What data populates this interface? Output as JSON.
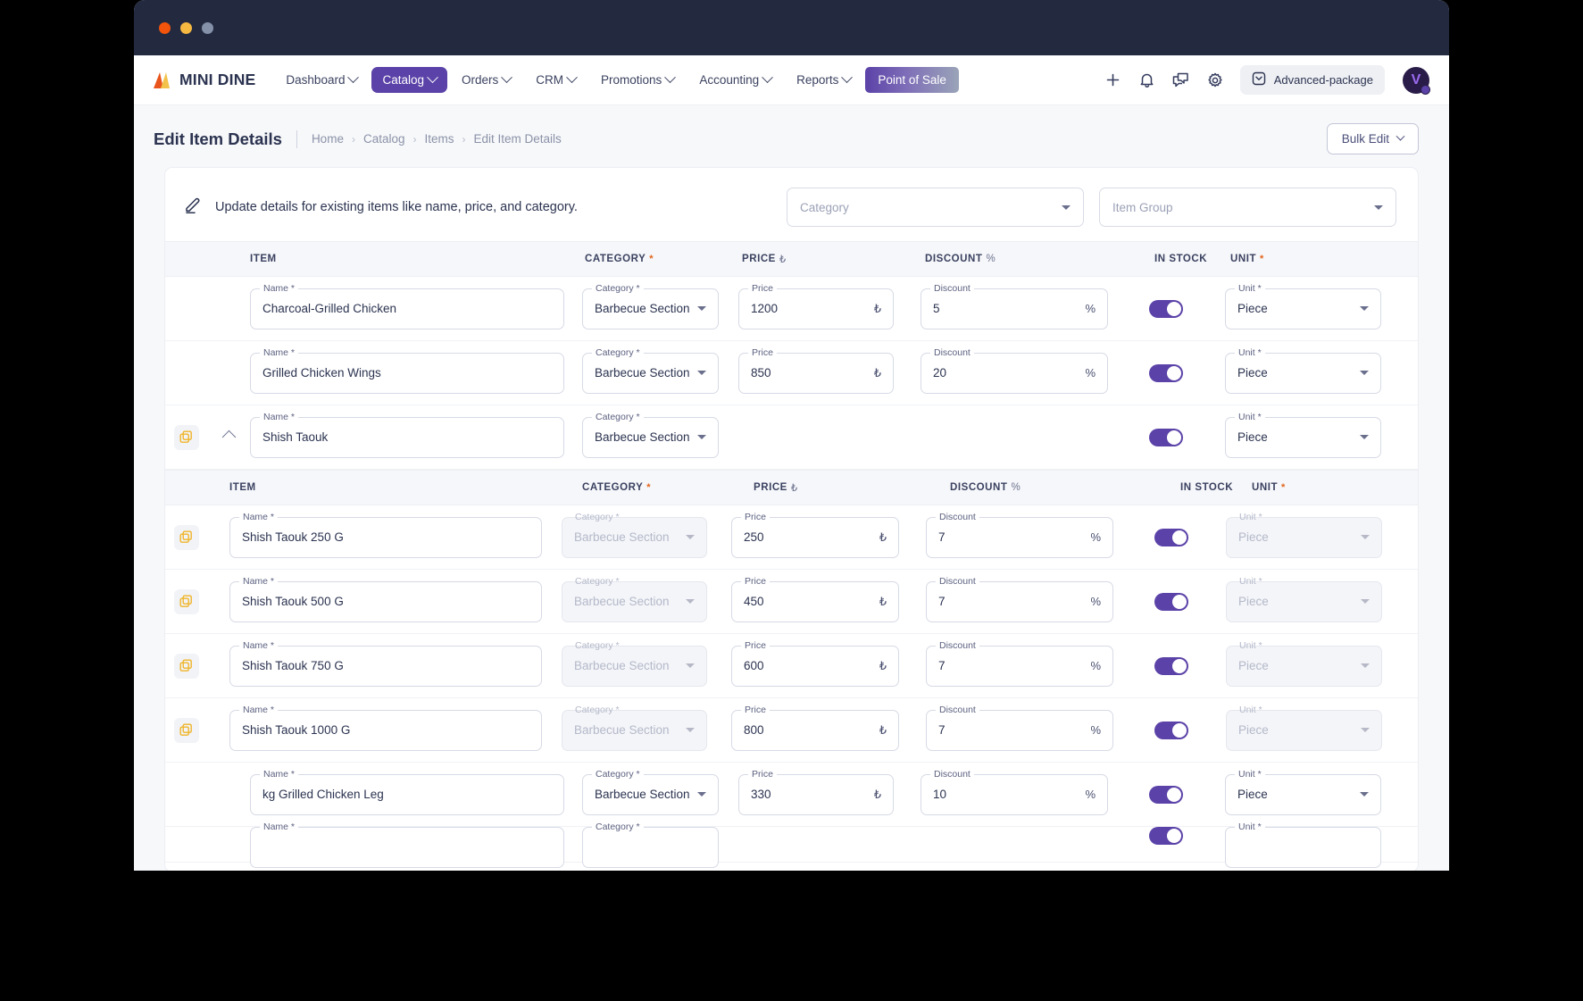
{
  "window": {
    "dots": [
      "close",
      "minimize",
      "maximize"
    ]
  },
  "nav": {
    "brand": "MINI DINE",
    "items": [
      {
        "label": "Dashboard",
        "caret": true,
        "active": false
      },
      {
        "label": "Catalog",
        "caret": true,
        "active": true
      },
      {
        "label": "Orders",
        "caret": true,
        "active": false
      },
      {
        "label": "CRM",
        "caret": true,
        "active": false
      },
      {
        "label": "Promotions",
        "caret": true,
        "active": false
      },
      {
        "label": "Accounting",
        "caret": true,
        "active": false
      },
      {
        "label": "Reports",
        "caret": true,
        "active": false
      }
    ],
    "pos_label": "Point of Sale",
    "icons": [
      "plus-icon",
      "bell-icon",
      "chat-icon",
      "gear-icon"
    ],
    "package_label": "Advanced-package",
    "avatar_initial": "V"
  },
  "header": {
    "title": "Edit Item Details",
    "breadcrumb": [
      "Home",
      "Catalog",
      "Items",
      "Edit Item Details"
    ],
    "bulk_edit_label": "Bulk Edit"
  },
  "card": {
    "description": "Update details for existing items like name, price, and category.",
    "filters": [
      {
        "placeholder": "Category"
      },
      {
        "placeholder": "Item Group"
      }
    ],
    "columns": {
      "item": "ITEM",
      "category": "CATEGORY",
      "price": "PRICE",
      "price_symbol": "₺",
      "discount": "DISCOUNT",
      "discount_symbol": "%",
      "in_stock": "IN STOCK",
      "unit": "UNIT",
      "required_mark": "*"
    },
    "field_labels": {
      "name": "Name *",
      "category": "Category *",
      "price": "Price",
      "discount": "Discount",
      "unit": "Unit *"
    },
    "rows": [
      {
        "name": "Charcoal-Grilled Chicken",
        "category": "Barbecue Section",
        "price": "1200",
        "discount": "5",
        "in_stock": true,
        "unit": "Piece",
        "expandable": false,
        "expanded": false
      },
      {
        "name": "Grilled  Chicken Wings",
        "category": "Barbecue Section",
        "price": "850",
        "discount": "20",
        "in_stock": true,
        "unit": "Piece",
        "expandable": false,
        "expanded": false
      },
      {
        "name": "Shish Taouk",
        "category": "Barbecue Section",
        "price": "",
        "discount": "",
        "in_stock": true,
        "unit": "Piece",
        "expandable": true,
        "expanded": true
      }
    ],
    "nested_rows": [
      {
        "name": "Shish Taouk 250 G",
        "category": "Barbecue Section",
        "price": "250",
        "discount": "7",
        "in_stock": true,
        "unit": "Piece"
      },
      {
        "name": "Shish Taouk 500 G",
        "category": "Barbecue Section",
        "price": "450",
        "discount": "7",
        "in_stock": true,
        "unit": "Piece"
      },
      {
        "name": "Shish Taouk 750 G",
        "category": "Barbecue Section",
        "price": "600",
        "discount": "7",
        "in_stock": true,
        "unit": "Piece"
      },
      {
        "name": "Shish Taouk 1000 G",
        "category": "Barbecue Section",
        "price": "800",
        "discount": "7",
        "in_stock": true,
        "unit": "Piece"
      }
    ],
    "trailing_rows": [
      {
        "name": "kg Grilled Chicken Leg",
        "category": "Barbecue Section",
        "price": "330",
        "discount": "10",
        "in_stock": true,
        "unit": "Piece"
      },
      {
        "name": "",
        "category": "",
        "price": "",
        "discount": "",
        "in_stock": true,
        "unit": ""
      }
    ]
  },
  "colors": {
    "brand_purple": "#5b42a8",
    "titlebar": "#232a40",
    "text_dark": "#2b3350",
    "copy_icon": "#f0b429",
    "required": "#e2641c"
  }
}
